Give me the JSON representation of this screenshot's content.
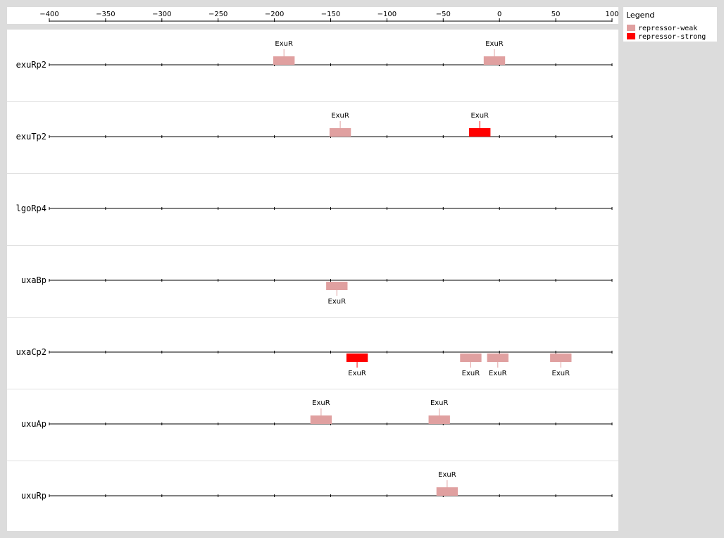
{
  "axis": {
    "min": -400,
    "max": 100,
    "ticks": [
      -400,
      -350,
      -300,
      -250,
      -200,
      -150,
      -100,
      -50,
      0,
      50,
      100
    ],
    "tick_labels": [
      "−400",
      "−350",
      "−300",
      "−250",
      "−200",
      "−150",
      "−100",
      "−50",
      "0",
      "50",
      "100"
    ]
  },
  "legend": {
    "title": "Legend",
    "items": [
      {
        "label": "repressor-weak",
        "color": "#e0a0a0"
      },
      {
        "label": "repressor-strong",
        "color": "#ff0000"
      }
    ]
  },
  "rows": [
    {
      "name": "exuRp2",
      "sites": [
        {
          "label": "ExuR",
          "start": -201,
          "end": -182,
          "type": "weak",
          "side": "above"
        },
        {
          "label": "ExuR",
          "start": -14,
          "end": 5,
          "type": "weak",
          "side": "above"
        }
      ]
    },
    {
      "name": "exuTp2",
      "sites": [
        {
          "label": "ExuR",
          "start": -151,
          "end": -132,
          "type": "weak",
          "side": "above"
        },
        {
          "label": "ExuR",
          "start": -27,
          "end": -8,
          "type": "strong",
          "side": "above"
        }
      ]
    },
    {
      "name": "lgoRp4",
      "sites": []
    },
    {
      "name": "uxaBp",
      "sites": [
        {
          "label": "ExuR",
          "start": -154,
          "end": -135,
          "type": "weak",
          "side": "below"
        }
      ]
    },
    {
      "name": "uxaCp2",
      "sites": [
        {
          "label": "ExuR",
          "start": -136,
          "end": -117,
          "type": "strong",
          "side": "below"
        },
        {
          "label": "ExuR",
          "start": -35,
          "end": -16,
          "type": "weak",
          "side": "below"
        },
        {
          "label": "ExuR",
          "start": -11,
          "end": 8,
          "type": "weak",
          "side": "below"
        },
        {
          "label": "ExuR",
          "start": 45,
          "end": 64,
          "type": "weak",
          "side": "below"
        }
      ]
    },
    {
      "name": "uxuAp",
      "sites": [
        {
          "label": "ExuR",
          "start": -168,
          "end": -149,
          "type": "weak",
          "side": "above"
        },
        {
          "label": "ExuR",
          "start": -63,
          "end": -44,
          "type": "weak",
          "side": "above"
        }
      ]
    },
    {
      "name": "uxuRp",
      "sites": [
        {
          "label": "ExuR",
          "start": -56,
          "end": -37,
          "type": "weak",
          "side": "above"
        }
      ]
    }
  ]
}
